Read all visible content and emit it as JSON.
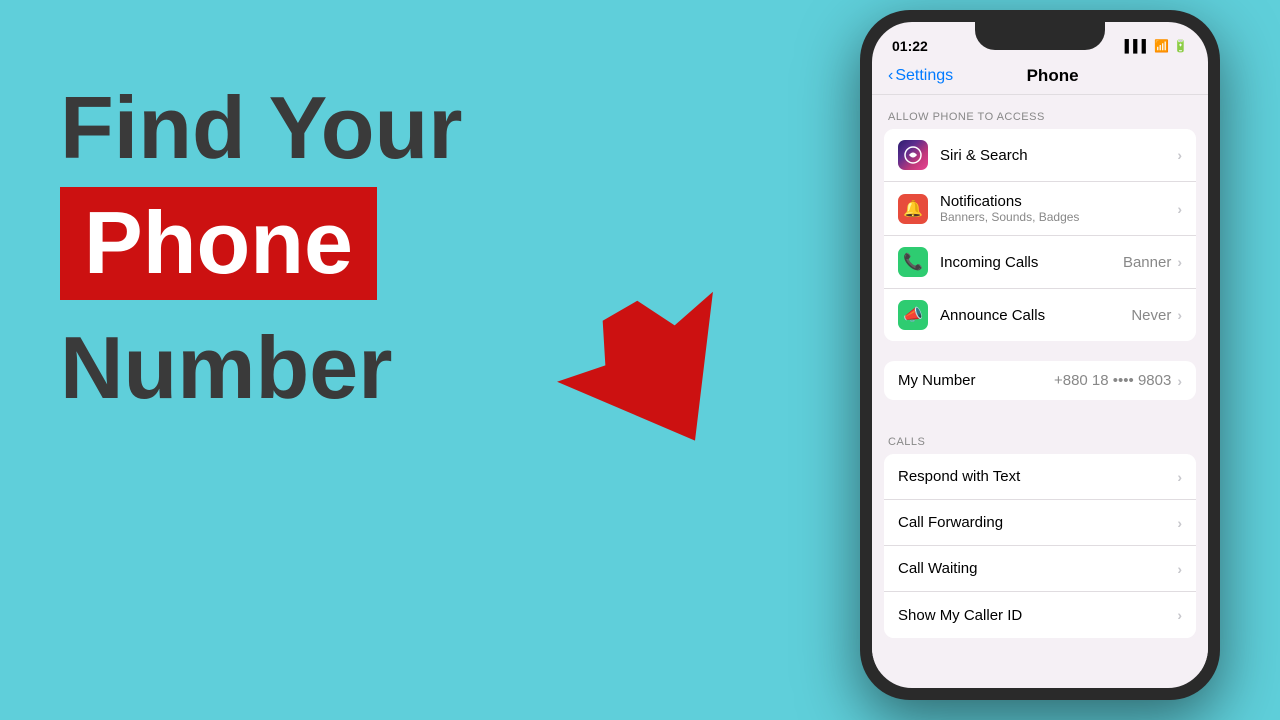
{
  "left": {
    "line1": "Find Your",
    "line2": "Phone",
    "line3": "Number"
  },
  "phone": {
    "status_time": "01:22",
    "back_label": "Settings",
    "page_title": "Phone",
    "section_access": "ALLOW PHONE TO ACCESS",
    "section_calls": "CALLS",
    "rows_access": [
      {
        "id": "siri",
        "label": "Siri & Search",
        "sublabel": "",
        "value": "",
        "icon_type": "siri"
      },
      {
        "id": "notifications",
        "label": "Notifications",
        "sublabel": "Banners, Sounds, Badges",
        "value": "",
        "icon_type": "notif"
      },
      {
        "id": "incoming",
        "label": "Incoming Calls",
        "sublabel": "",
        "value": "Banner",
        "icon_type": "incoming"
      },
      {
        "id": "announce",
        "label": "Announce Calls",
        "sublabel": "",
        "value": "Never",
        "icon_type": "announce"
      }
    ],
    "my_number_label": "My Number",
    "my_number_value": "+880 18 •••• 9803",
    "rows_calls": [
      {
        "id": "respond",
        "label": "Respond with Text"
      },
      {
        "id": "forwarding",
        "label": "Call Forwarding"
      },
      {
        "id": "waiting",
        "label": "Call Waiting"
      },
      {
        "id": "callerid",
        "label": "Show My Caller ID"
      }
    ]
  }
}
